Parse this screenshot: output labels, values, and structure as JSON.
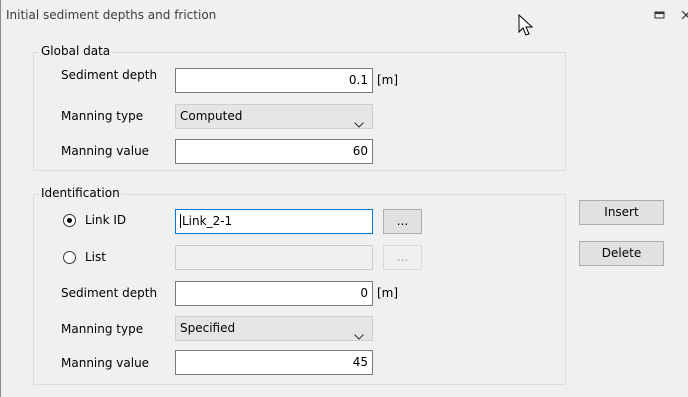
{
  "window": {
    "title": "Initial sediment depths and friction"
  },
  "global": {
    "group_title": "Global data",
    "sediment_depth_label": "Sediment depth",
    "sediment_depth_value": "0.1",
    "sediment_depth_unit": "[m]",
    "manning_type_label": "Manning type",
    "manning_type_value": "Computed",
    "manning_value_label": "Manning value",
    "manning_value_value": "60"
  },
  "identification": {
    "group_title": "Identification",
    "link_id_label": "Link ID",
    "link_id_value": "Link_2-1",
    "link_browse_label": "...",
    "list_label": "List",
    "list_value": "",
    "list_browse_label": "...",
    "selected_option": "Link ID",
    "sediment_depth_label": "Sediment depth",
    "sediment_depth_value": "0",
    "sediment_depth_unit": "[m]",
    "manning_type_label": "Manning type",
    "manning_type_value": "Specified",
    "manning_value_label": "Manning value",
    "manning_value_value": "45"
  },
  "actions": {
    "insert_label": "Insert",
    "delete_label": "Delete"
  },
  "icons": {
    "maximize": "maximize-icon",
    "close": "close-icon",
    "cursor": "mouse-pointer-icon",
    "chevron": "chevron-down-icon"
  },
  "colors": {
    "window_bg": "#f0f0f0",
    "focus_border": "#0078d7"
  }
}
